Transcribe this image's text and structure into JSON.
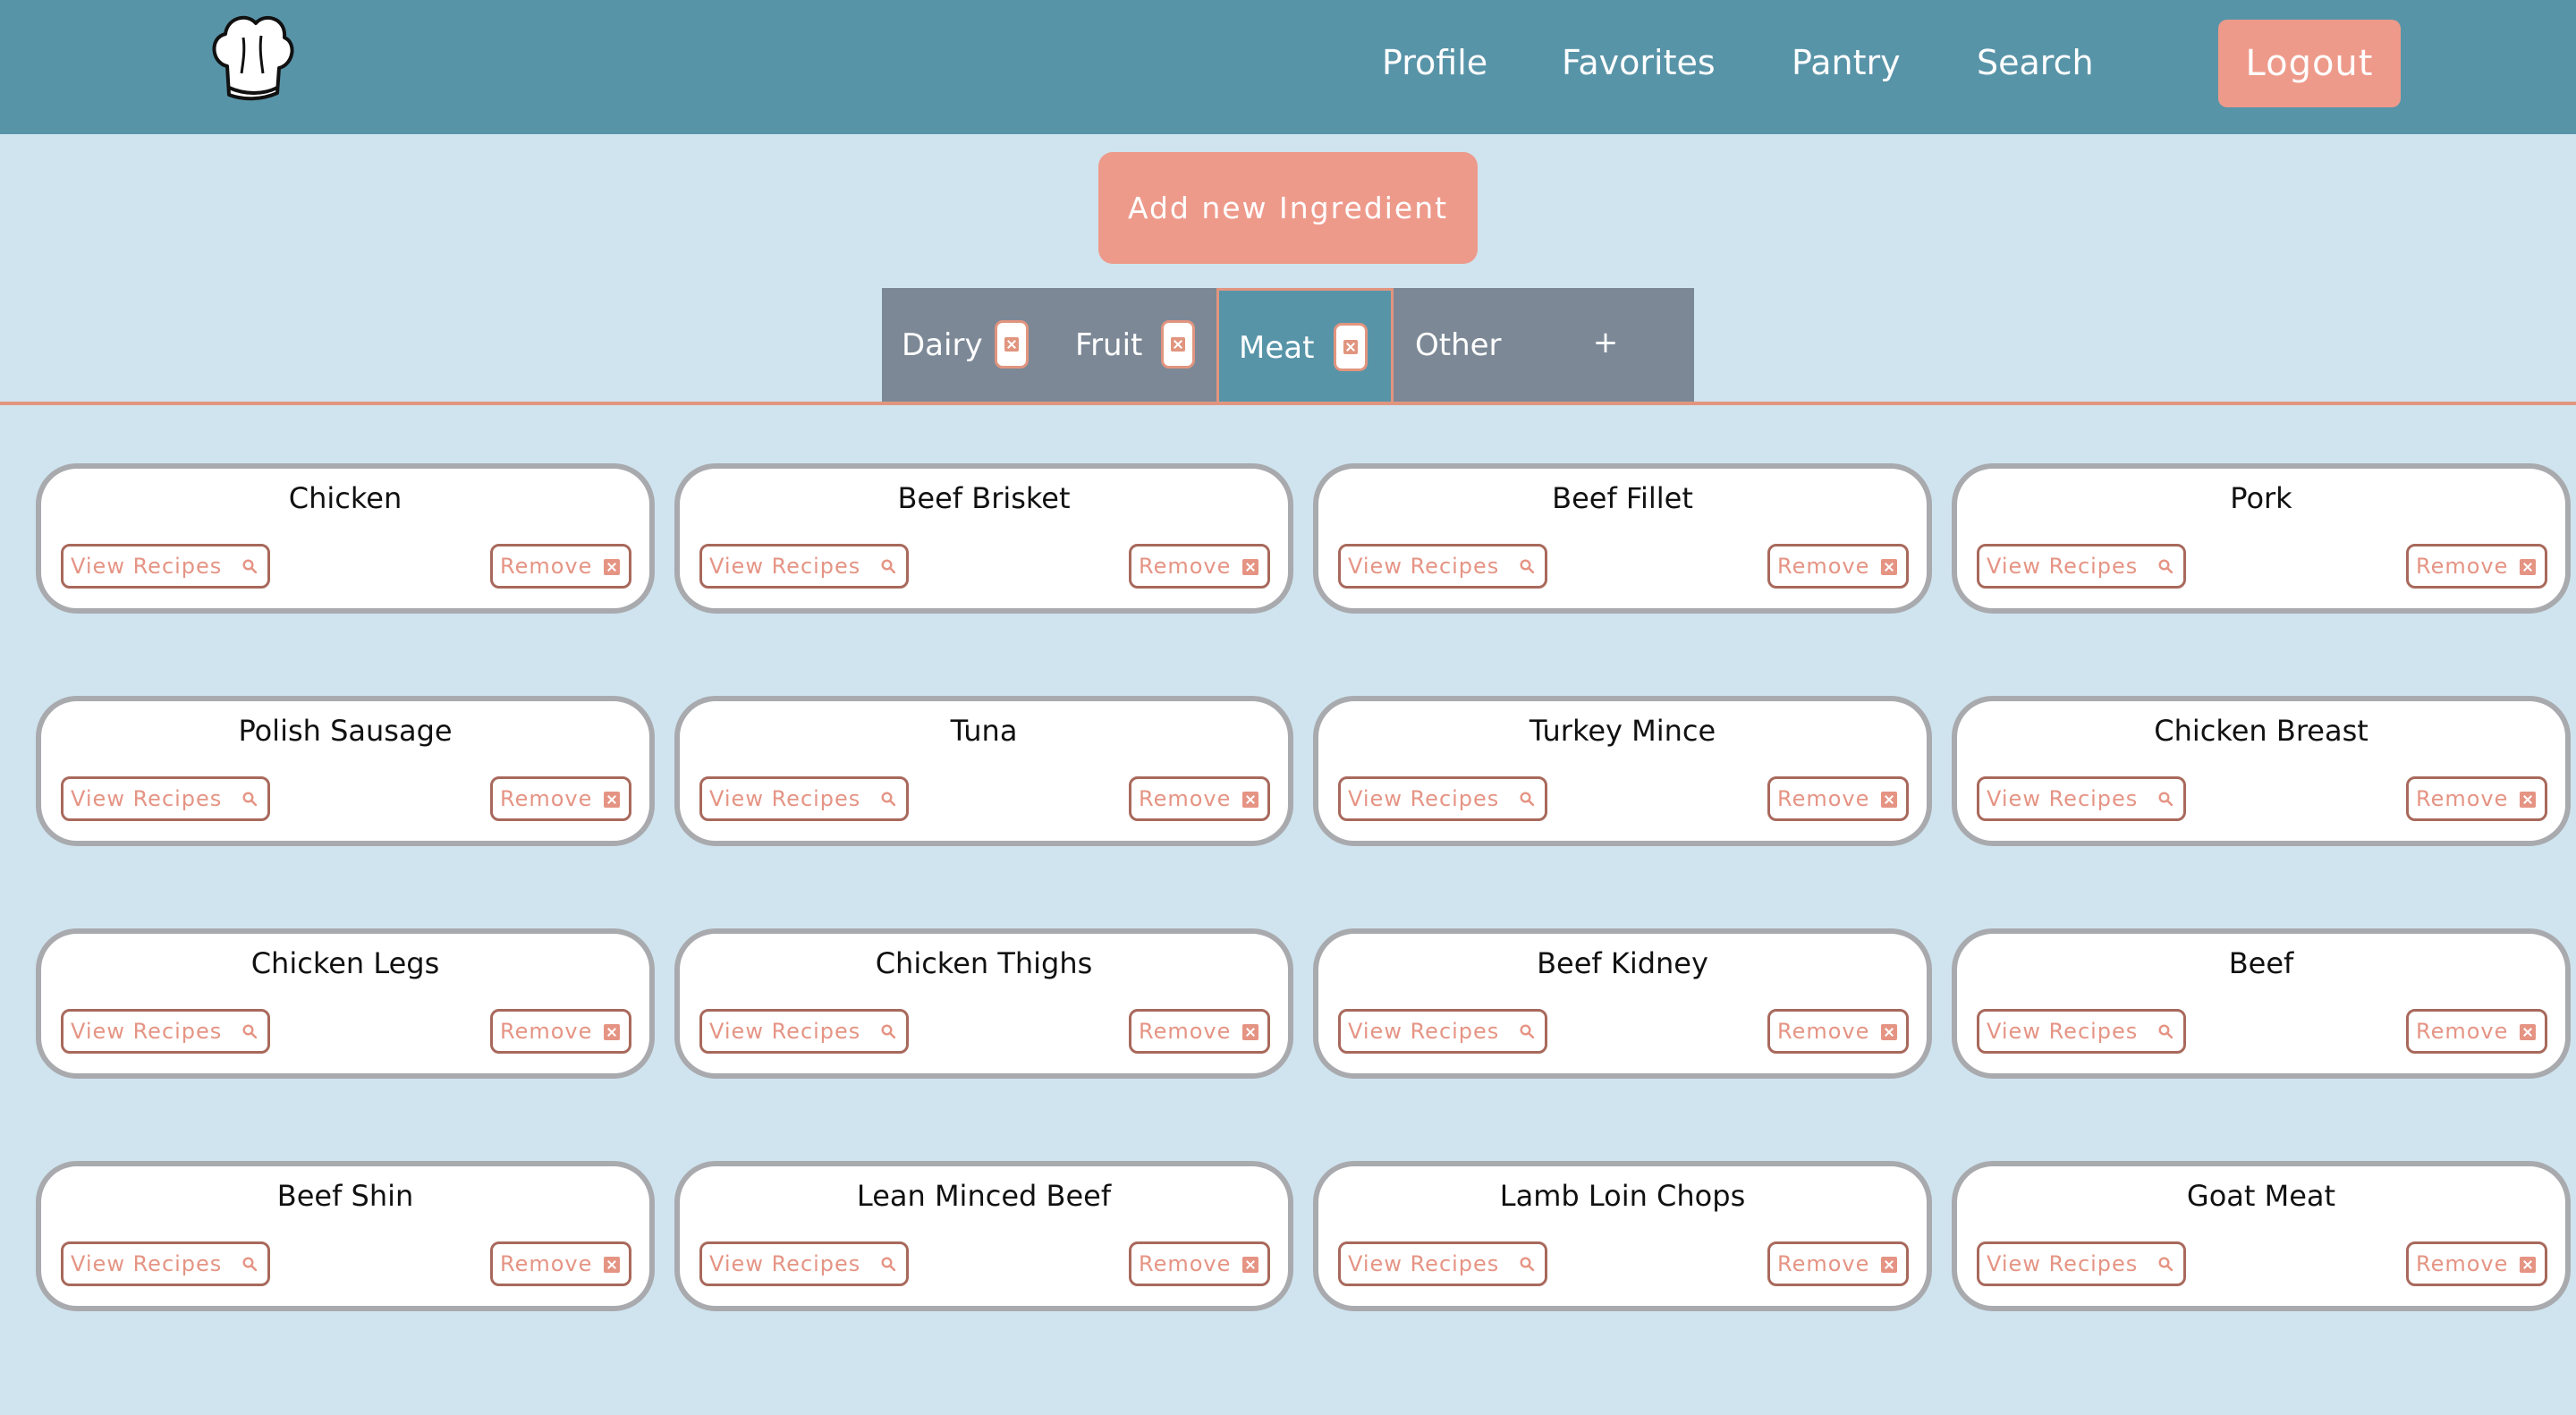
{
  "header": {
    "logo_icon": "chef-hat-icon",
    "nav": [
      "Profile",
      "Favorites",
      "Pantry",
      "Search"
    ],
    "logout_label": "Logout"
  },
  "actions": {
    "add_ingredient_label": "Add new Ingredient"
  },
  "tabs": [
    {
      "label": "Dairy",
      "active": false,
      "removable": true
    },
    {
      "label": "Fruit",
      "active": false,
      "removable": true
    },
    {
      "label": "Meat",
      "active": true,
      "removable": true
    },
    {
      "label": "Other",
      "active": false,
      "removable": false
    }
  ],
  "add_tab_label": "+",
  "ingredients": [
    "Chicken",
    "Beef Brisket",
    "Beef Fillet",
    "Pork",
    "Polish Sausage",
    "Tuna",
    "Turkey Mince",
    "Chicken Breast",
    "Chicken Legs",
    "Chicken Thighs",
    "Beef Kidney",
    "Beef",
    "Beef Shin",
    "Lean Minced Beef",
    "Lamb Loin Chops",
    "Goat Meat"
  ],
  "card_buttons": {
    "view_label": "View Recipes",
    "remove_label": "Remove"
  },
  "colors": {
    "header": "#5894a8",
    "background": "#cfe4ef",
    "accent": "#ee9a8b",
    "tabbar": "#7c8896",
    "card_border": "#a9aaae"
  }
}
